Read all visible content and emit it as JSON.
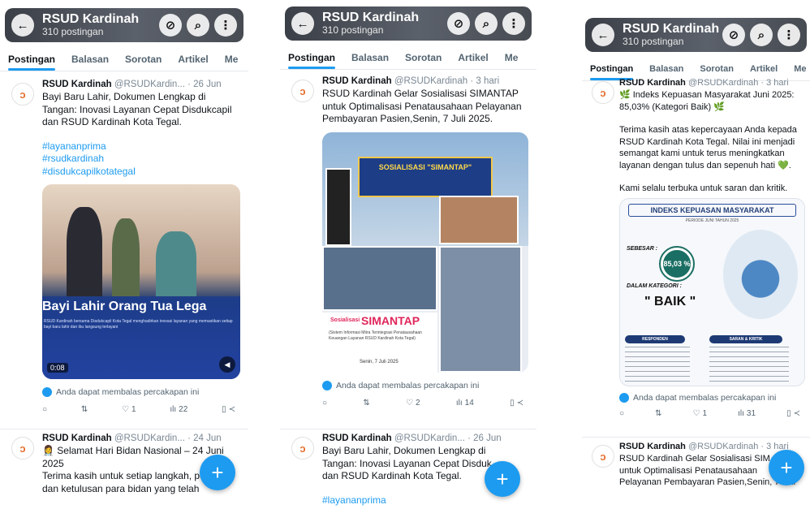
{
  "profile": {
    "name": "RSUD Kardinah",
    "posts_count": "310 postingan",
    "handle_short": "@RSUDKardin...",
    "handle_full": "@RSUDKardinah"
  },
  "tabs": [
    "Postingan",
    "Balasan",
    "Sorotan",
    "Artikel",
    "Me"
  ],
  "reply_notice": "Anda dapat membalas percakapan ini",
  "phone1": {
    "post1": {
      "time": "· 26 Jun",
      "text": "Bayi Baru Lahir, Dokumen Lengkap di Tangan: Inovasi Layanan Cepat Disdukcapil dan RSUD Kardinah Kota Tegal.",
      "tags": [
        "#layananprima",
        "#rsudkardinah",
        "#disdukcapilkotategal"
      ],
      "media_title": "Bayi Lahir Orang Tua Lega",
      "media_caption": "RSUD Kardinah bersama Disdukcapil Kota Tegal menghadirkan inovasi layanan yang memastikan setiap bayi baru lahir dan ibu langsung terlayani",
      "video_time": "0:08",
      "stats": {
        "reply": "",
        "repost": "",
        "like": "1",
        "views": "22"
      }
    },
    "post2": {
      "time": "· 24 Jun",
      "text_lines": [
        "👩‍⚕️ Selamat Hari Bidan Nasional – 24 Juni",
        "2025",
        "Terima kasih untuk setiap langkah, pe",
        "dan ketulusan para bidan yang telah"
      ]
    }
  },
  "phone2": {
    "post1": {
      "time": "· 3 hari",
      "text": "RSUD Kardinah Gelar Sosialisasi SIMANTAP untuk Optimalisasi Penatausahaan Pelayanan Pembayaran Pasien,Senin, 7 Juli 2025.",
      "banner_text": "SOSIALISASI \"SIMANTAP\"",
      "simantap_small": "Sosialisasi",
      "simantap_big": "SIMANTAP",
      "simantap_desc": "(Sistem Informasi Mitra Terintegrasi Penatausahaan Keuangan Layanan RSUD Kardinah Kota Tegal)",
      "simantap_date": "Senin, 7 Juli 2025",
      "stats": {
        "reply": "",
        "repost": "",
        "like": "2",
        "views": "14"
      }
    },
    "post2": {
      "time": "· 26 Jun",
      "text_lines": [
        "Bayi Baru Lahir, Dokumen Lengkap di",
        "Tangan: Inovasi Layanan Cepat Disduk",
        "dan RSUD Kardinah Kota Tegal."
      ],
      "tag_partial": "#layananprima"
    }
  },
  "phone3": {
    "post1": {
      "time": "· 3 hari",
      "text1": "🌿 Indeks Kepuasan Masyarakat Juni 2025: 85,03% (Kategori Baik) 🌿",
      "text2": "Terima kasih atas kepercayaan Anda kepada RSUD Kardinah Kota Tegal. Nilai ini menjadi semangat kami untuk terus meningkatkan layanan dengan tulus dan sepenuh hati 💚.",
      "text3": "Kami selalu terbuka untuk saran dan kritik.",
      "ikm_title": "INDEKS KEPUASAN MASYARAKAT",
      "ikm_period": "PERIODE JUNI TAHUN 2025",
      "sebesar": "SEBESAR :",
      "score": "85,03 %",
      "kategori": "DALAM KATEGORI :",
      "baik": "\" BAIK \"",
      "responden": "RESPONDEN",
      "saran": "SARAN & KRITIK",
      "stats": {
        "reply": "",
        "repost": "",
        "like": "1",
        "views": "31"
      }
    },
    "post2": {
      "time": "· 3 hari",
      "text_lines": [
        "RSUD Kardinah Gelar Sosialisasi SIM",
        "untuk Optimalisasi Penatausahaan",
        "Pelayanan Pembayaran Pasien,Senin, 7 Juli"
      ]
    }
  },
  "icons": {
    "back": "back-arrow-icon",
    "grok": "grok-icon",
    "search": "search-icon",
    "more": "more-vertical-icon",
    "compose": "plus-icon"
  },
  "colors": {
    "accent": "#1d9bf0",
    "text": "#0f1419",
    "muted": "#536471"
  }
}
